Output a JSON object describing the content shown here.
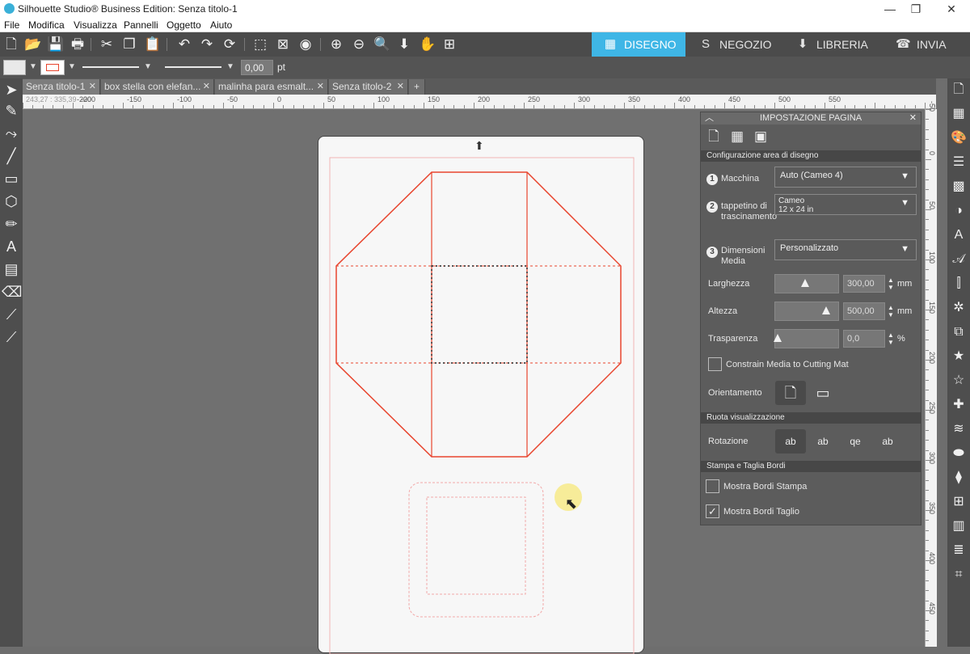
{
  "window": {
    "title": "Silhouette Studio® Business Edition: Senza titolo-1",
    "controls": [
      "—",
      "❐",
      "✕"
    ]
  },
  "menu": [
    "File",
    "Modifica",
    "Visualizza",
    "Pannelli",
    "Oggetto",
    "Aiuto"
  ],
  "modes": [
    {
      "label": "DISEGNO",
      "icon": "grid-icon",
      "active": true
    },
    {
      "label": "NEGOZIO",
      "icon": "silhouette-s-icon",
      "active": false
    },
    {
      "label": "LIBRERIA",
      "icon": "library-icon",
      "active": false
    },
    {
      "label": "INVIA",
      "icon": "send-icon",
      "active": false
    }
  ],
  "propbar": {
    "line_width_value": "0,00",
    "unit": "pt"
  },
  "tabs": [
    {
      "label": "Senza titolo-1",
      "active": true
    },
    {
      "label": "box stella con elefan...",
      "active": false
    },
    {
      "label": "malinha para esmalt...",
      "active": false
    },
    {
      "label": "Senza titolo-2",
      "active": false
    }
  ],
  "ruler": {
    "coords": "243,27 : 335,39",
    "h_labels": [
      "-250",
      "-200",
      "-150",
      "-100",
      "-50",
      "0",
      "50",
      "100",
      "150",
      "200",
      "250",
      "300",
      "350",
      "400",
      "450",
      "500",
      "550"
    ],
    "v_labels": [
      "-50",
      "0",
      "50",
      "100",
      "150",
      "200",
      "250",
      "300",
      "350",
      "400",
      "450"
    ]
  },
  "panel": {
    "title": "IMPOSTAZIONE PAGINA",
    "section1": "Configurazione area di disegno",
    "machine_label": "Macchina",
    "machine_value": "Auto (Cameo 4)",
    "mat_label": "tappetino di trascinamento",
    "mat_value_line1": "Cameo",
    "mat_value_line2": "12 x 24 in",
    "media_label": "Dimensioni Media",
    "media_value": "Personalizzato",
    "width_label": "Larghezza",
    "width_value": "300,00",
    "height_label": "Altezza",
    "height_value": "500,00",
    "transparency_label": "Trasparenza",
    "transparency_value": "0,0",
    "unit_mm": "mm",
    "unit_pct": "%",
    "constrain_label": "Constrain Media to Cutting Mat",
    "orientation_label": "Orientamento",
    "section2": "Ruota visualizzazione",
    "rotation_label": "Rotazione",
    "section3": "Stampa e Taglia Bordi",
    "show_print_borders": "Mostra Bordi Stampa",
    "show_cut_borders": "Mostra Bordi Taglio",
    "show_print_checked": false,
    "show_cut_checked": true
  },
  "colors": {
    "accent": "#3fb6e6",
    "cut_line": "#e8452e",
    "panel_bg": "#5c5c5c"
  }
}
